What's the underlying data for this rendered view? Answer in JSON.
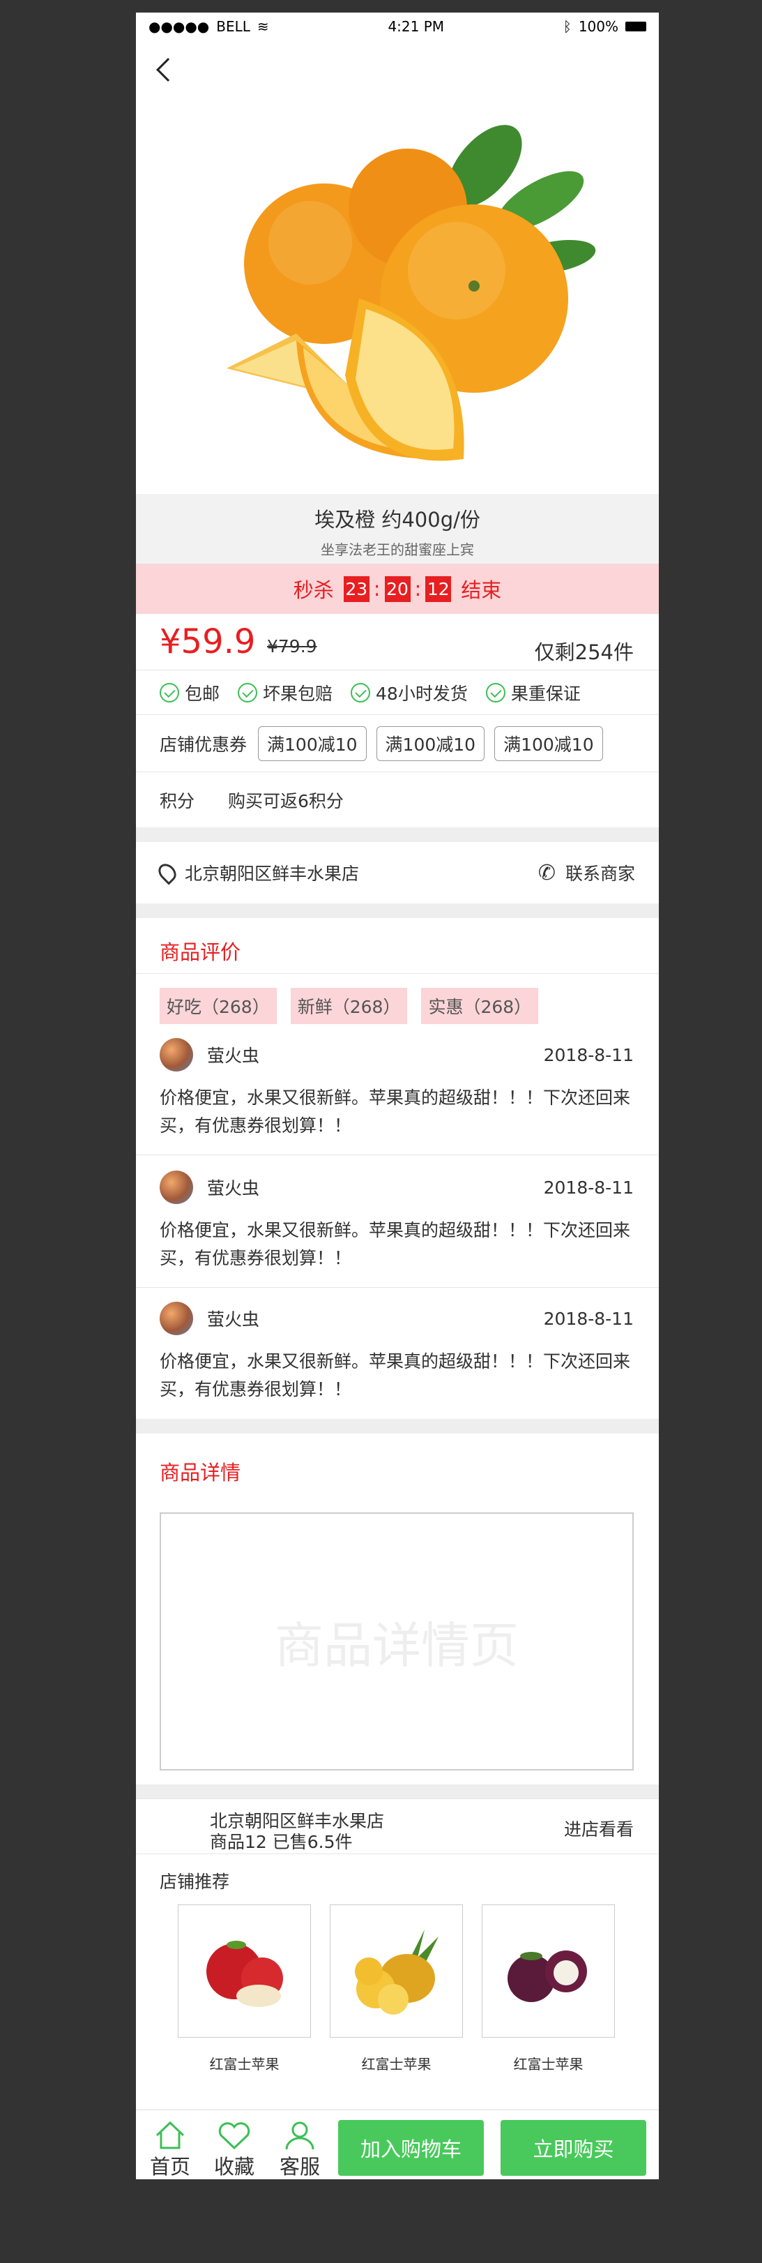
{
  "status_bar": {
    "carrier": "BELL",
    "time": "4:21 PM",
    "battery": "100%"
  },
  "product": {
    "name": "埃及橙    约400g/份",
    "subtitle": "坐享法老王的甜蜜座上宾",
    "flash_sale": {
      "label": "秒杀",
      "h": "23",
      "m": "20",
      "s": "12",
      "end": "结束"
    },
    "price": "¥59.9",
    "old_price": "¥79.9",
    "stock": "仅剩254件"
  },
  "guarantees": [
    "包邮",
    "坏果包赔",
    "48小时发货",
    "果重保证"
  ],
  "coupons": {
    "label": "店铺优惠券",
    "items": [
      "满100减10",
      "满100减10",
      "满100减10"
    ]
  },
  "points": {
    "label": "积分",
    "text": "购买可返6积分"
  },
  "store_row": {
    "address": "北京朝阳区鲜丰水果店",
    "contact": "联系商家"
  },
  "reviews": {
    "title": "商品评价",
    "tags": [
      "好吃（268）",
      "新鲜（268）",
      "实惠（268）"
    ],
    "items": [
      {
        "user": "萤火虫",
        "date": "2018-8-11",
        "text": "价格便宜，水果又很新鲜。苹果真的超级甜！！！下次还回来买，有优惠券很划算！！"
      },
      {
        "user": "萤火虫",
        "date": "2018-8-11",
        "text": "价格便宜，水果又很新鲜。苹果真的超级甜！！！下次还回来买，有优惠券很划算！！"
      },
      {
        "user": "萤火虫",
        "date": "2018-8-11",
        "text": "价格便宜，水果又很新鲜。苹果真的超级甜！！！下次还回来买，有优惠券很划算！！"
      }
    ]
  },
  "detail": {
    "title": "商品详情",
    "placeholder": "商品详情页"
  },
  "shop": {
    "name": "北京朝阳区鲜丰水果店",
    "stats": "商品12    已售6.5件",
    "visit": "进店看看",
    "rec_title": "店铺推荐",
    "recs": [
      "红富士苹果",
      "红富士苹果",
      "红富士苹果"
    ]
  },
  "tabbar": {
    "home": "首页",
    "fav": "收藏",
    "service": "客服",
    "cart": "加入购物车",
    "buy": "立即购买"
  },
  "colors": {
    "accent": "#e71f21",
    "green": "#49c95c",
    "pink": "#fbd5d8"
  }
}
